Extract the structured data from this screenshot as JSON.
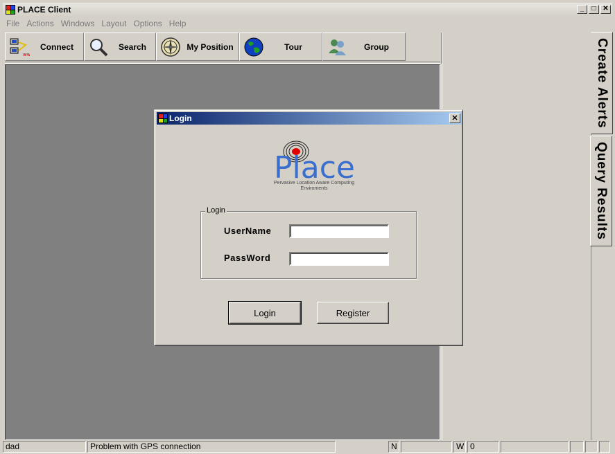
{
  "window": {
    "title": "PLACE Client"
  },
  "menu": [
    "File",
    "Actions",
    "Windows",
    "Layout",
    "Options",
    "Help"
  ],
  "toolbar": {
    "connect": "Connect",
    "search": "Search",
    "my_position": "My Position",
    "tour": "Tour",
    "group": "Group"
  },
  "side_tabs": {
    "create_alerts": "Create Alerts",
    "query_results": "Query Results"
  },
  "status": {
    "user": "dad",
    "message": "Problem with GPS connection",
    "lat_dir": "N",
    "lon_dir": "W",
    "lon_value": "0"
  },
  "dialog": {
    "title": "Login",
    "logo_word": "Place",
    "logo_tagline_1": "Pervasive Location Aware Computing",
    "logo_tagline_2": "Enviroments",
    "group_label": "Login",
    "username_label": "UserName",
    "password_label": "PassWord",
    "username_value": "",
    "password_value": "",
    "login_button": "Login",
    "register_button": "Register"
  },
  "colors": {
    "face": "#d4d0c8",
    "mdi_background": "#808080",
    "titlebar_start": "#0a246a",
    "titlebar_end": "#a6caf0",
    "logo_blue": "#3a6fd0",
    "logo_red": "#e00000"
  }
}
